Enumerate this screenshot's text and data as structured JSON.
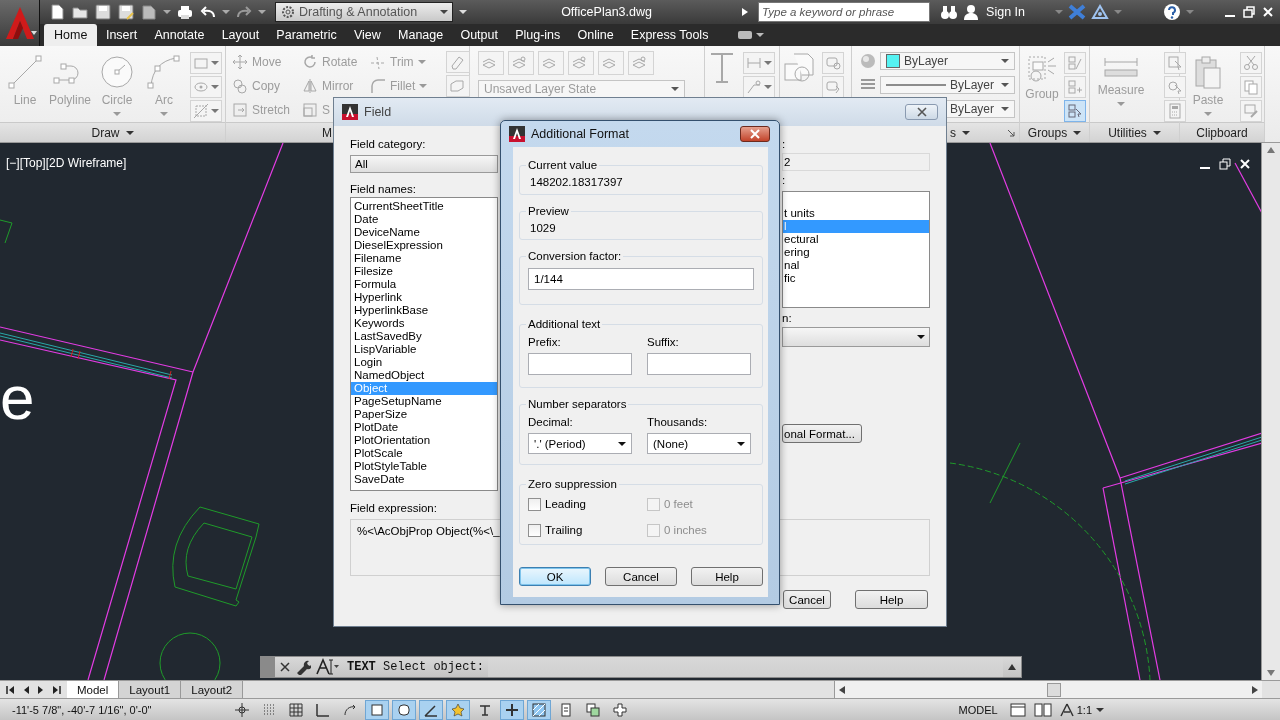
{
  "title_bar": {
    "workspace": "Drafting & Annotation",
    "document": "OfficePlan3.dwg",
    "search_placeholder": "Type a keyword or phrase",
    "sign_in": "Sign In"
  },
  "ribbon_tabs": [
    {
      "label": "Home",
      "selected": true
    },
    {
      "label": "Insert",
      "selected": false
    },
    {
      "label": "Annotate",
      "selected": false
    },
    {
      "label": "Layout",
      "selected": false
    },
    {
      "label": "Parametric",
      "selected": false
    },
    {
      "label": "View",
      "selected": false
    },
    {
      "label": "Manage",
      "selected": false
    },
    {
      "label": "Output",
      "selected": false
    },
    {
      "label": "Plug-ins",
      "selected": false
    },
    {
      "label": "Online",
      "selected": false
    },
    {
      "label": "Express Tools",
      "selected": false
    }
  ],
  "ribbon": {
    "draw": {
      "tools": [
        "Line",
        "Polyline",
        "Circle",
        "Arc"
      ],
      "title": "Draw"
    },
    "modify": {
      "tools": [
        "Move",
        "Rotate",
        "Trim",
        "Copy",
        "Mirror",
        "Fillet",
        "Stretch",
        "S"
      ],
      "title": "M"
    },
    "layers": {
      "layer_state": "Unsaved Layer State"
    },
    "properties": {
      "color_value": "ByLayer",
      "lineweight": "ByLayer",
      "linetype": "ByLayer",
      "title": "s"
    },
    "groups": {
      "tool": "Group",
      "title": "Groups"
    },
    "utilities": {
      "tool": "Measure",
      "title": "Utilities"
    },
    "clipboard": {
      "tool": "Paste",
      "title": "Clipboard"
    }
  },
  "viewport": {
    "label": "[−][Top][2D Wireframe]",
    "text_fragment": "e"
  },
  "command_line": {
    "prompt": "**TEXT** Select object:"
  },
  "layout_tabs": [
    {
      "label": "Model",
      "selected": true
    },
    {
      "label": "Layout1",
      "selected": false
    },
    {
      "label": "Layout2",
      "selected": false
    }
  ],
  "status_bar": {
    "coordinates": "-11'-5 7/8\", -40'-7 1/16\", 0'-0\"",
    "toggles": [
      {
        "on": false
      },
      {
        "on": false
      },
      {
        "on": false
      },
      {
        "on": false
      },
      {
        "on": false
      },
      {
        "on": true
      },
      {
        "on": true
      },
      {
        "on": true
      },
      {
        "on": true
      },
      {
        "on": false
      },
      {
        "on": true
      },
      {
        "on": true
      },
      {
        "on": false
      },
      {
        "on": false
      },
      {
        "on": false
      }
    ],
    "space": "MODEL",
    "scale": "1:1"
  },
  "field_dialog": {
    "title": "Field",
    "category_label": "Field category:",
    "category": "All",
    "names_label": "Field names:",
    "names": [
      {
        "label": "CurrentSheetTitle",
        "selected": false
      },
      {
        "label": "Date",
        "selected": false
      },
      {
        "label": "DeviceName",
        "selected": false
      },
      {
        "label": "DieselExpression",
        "selected": false
      },
      {
        "label": "Filename",
        "selected": false
      },
      {
        "label": "Filesize",
        "selected": false
      },
      {
        "label": "Formula",
        "selected": false
      },
      {
        "label": "Hyperlink",
        "selected": false
      },
      {
        "label": "HyperlinkBase",
        "selected": false
      },
      {
        "label": "Keywords",
        "selected": false
      },
      {
        "label": "LastSavedBy",
        "selected": false
      },
      {
        "label": "LispVariable",
        "selected": false
      },
      {
        "label": "Login",
        "selected": false
      },
      {
        "label": "NamedObject",
        "selected": false
      },
      {
        "label": "Object",
        "selected": true
      },
      {
        "label": "PageSetupName",
        "selected": false
      },
      {
        "label": "PaperSize",
        "selected": false
      },
      {
        "label": "PlotDate",
        "selected": false
      },
      {
        "label": "PlotOrientation",
        "selected": false
      },
      {
        "label": "PlotScale",
        "selected": false
      },
      {
        "label": "PlotStyleTable",
        "selected": false
      },
      {
        "label": "SaveDate",
        "selected": false
      }
    ],
    "format_labels": [
      ":",
      ":",
      "n:"
    ],
    "format_value": "2",
    "format_list": [
      {
        "label": "t units",
        "selected": false
      },
      {
        "label": "l",
        "selected": true
      },
      {
        "label": "ectural",
        "selected": false
      },
      {
        "label": "ering",
        "selected": false
      },
      {
        "label": "nal",
        "selected": false
      },
      {
        "label": "fic",
        "selected": false
      }
    ],
    "format_button": "onal Format...",
    "expression_label": "Field expression:",
    "expression": "%<\\AcObjProp Object(%<\\_",
    "buttons": [
      "Cancel",
      "Help"
    ]
  },
  "format_dialog": {
    "title": "Additional Format",
    "current_value_label": "Current value",
    "current_value": "148202.18317397",
    "preview_label": "Preview",
    "preview": "1029",
    "conversion_label": "Conversion factor:",
    "conversion": "1/144",
    "additional_text_label": "Additional text",
    "prefix_label": "Prefix:",
    "suffix_label": "Suffix:",
    "separators_label": "Number separators",
    "decimal_label": "Decimal:",
    "decimal": "'.' (Period)",
    "thousands_label": "Thousands:",
    "thousands": "(None)",
    "zero_label": "Zero suppression",
    "zero_options": [
      {
        "label": "Leading",
        "checked": false,
        "disabled": false
      },
      {
        "label": "0 feet",
        "checked": false,
        "disabled": true
      },
      {
        "label": "Trailing",
        "checked": false,
        "disabled": false
      },
      {
        "label": "0 inches",
        "checked": false,
        "disabled": true
      }
    ],
    "buttons": [
      {
        "label": "OK",
        "default": true
      },
      {
        "label": "Cancel",
        "default": false
      },
      {
        "label": "Help",
        "default": false
      }
    ]
  }
}
